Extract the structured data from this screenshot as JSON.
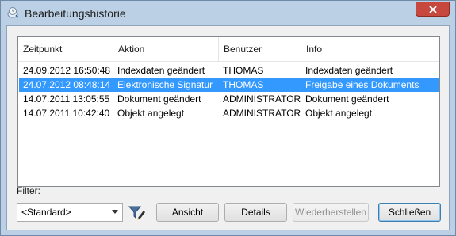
{
  "window": {
    "title": "Bearbeitungshistorie"
  },
  "list": {
    "columns": [
      "Zeitpunkt",
      "Aktion",
      "Benutzer",
      "Info"
    ],
    "rows": [
      {
        "zeitpunkt": "24.09.2012 16:50:48",
        "aktion": "Indexdaten geändert",
        "benutzer": "THOMAS",
        "info": "Indexdaten geändert",
        "selected": false
      },
      {
        "zeitpunkt": "24.07.2012 08:48:14",
        "aktion": "Elektronische Signatur",
        "benutzer": "THOMAS",
        "info": "Freigabe eines Dokuments",
        "selected": true
      },
      {
        "zeitpunkt": "14.07.2011 13:05:55",
        "aktion": "Dokument geändert",
        "benutzer": "ADMINISTRATOR",
        "info": "Dokument geändert",
        "selected": false
      },
      {
        "zeitpunkt": "14.07.2011 10:42:40",
        "aktion": "Objekt angelegt",
        "benutzer": "ADMINISTRATOR",
        "info": "Objekt angelegt",
        "selected": false
      }
    ]
  },
  "filter": {
    "label": "Filter:",
    "selected": "<Standard>"
  },
  "buttons": {
    "ansicht": "Ansicht",
    "details": "Details",
    "wiederherstellen": "Wiederherstellen",
    "schliessen": "Schließen"
  },
  "colors": {
    "selection": "#3399ff",
    "titlebar": "#bcd0e5",
    "close": "#c7483e"
  },
  "icons": {
    "window": "history-icon",
    "close": "close-icon",
    "filter": "filter-edit-icon",
    "dropdown": "chevron-down-icon"
  }
}
